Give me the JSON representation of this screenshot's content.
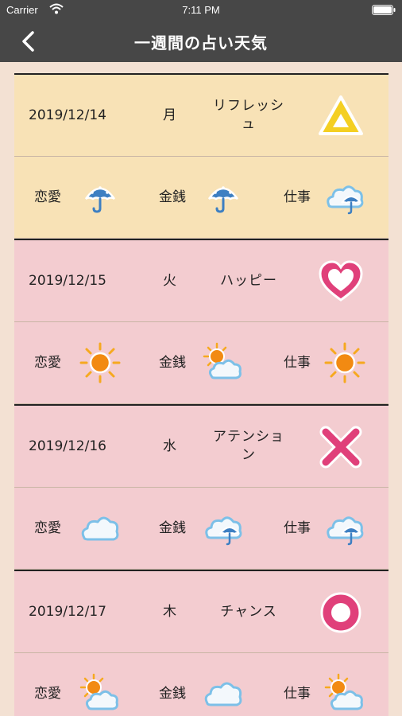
{
  "status_bar": {
    "carrier": "Carrier",
    "time": "7:11 PM"
  },
  "nav": {
    "title": "一週間の占い天気"
  },
  "labels": {
    "love": "恋愛",
    "money": "金銭",
    "work": "仕事"
  },
  "days": [
    {
      "date": "2019/12/14",
      "weekday": "月",
      "fortune": "リフレッシュ",
      "symbol": "triangle-icon",
      "love": "umbrella-icon",
      "money": "umbrella-icon",
      "work": "cloud-umbrella-icon"
    },
    {
      "date": "2019/12/15",
      "weekday": "火",
      "fortune": "ハッピー",
      "symbol": "heart-icon",
      "love": "sun-icon",
      "money": "sun-cloud-icon",
      "work": "sun-icon"
    },
    {
      "date": "2019/12/16",
      "weekday": "水",
      "fortune": "アテンション",
      "symbol": "cross-icon",
      "love": "cloud-icon",
      "money": "cloud-umbrella-icon",
      "work": "cloud-umbrella-icon"
    },
    {
      "date": "2019/12/17",
      "weekday": "木",
      "fortune": "チャンス",
      "symbol": "circle-icon",
      "love": "sun-cloud-icon",
      "money": "cloud-icon",
      "work": "sun-cloud-icon"
    }
  ]
}
